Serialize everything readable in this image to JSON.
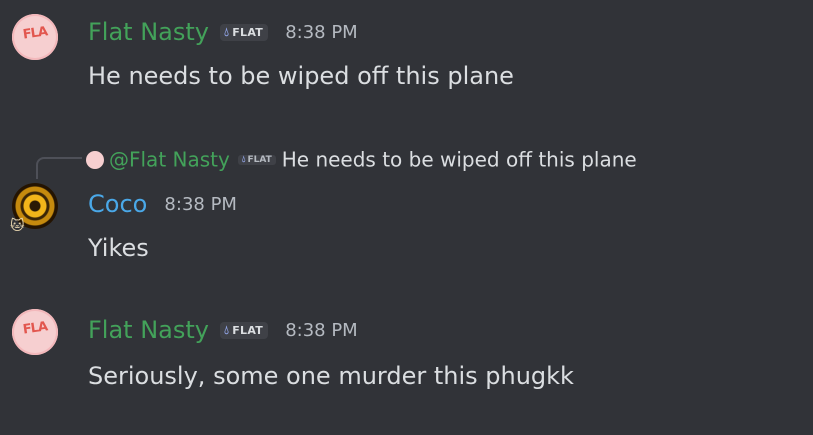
{
  "colors": {
    "background": "#313338",
    "flat_nasty_name": "#43a25a",
    "coco_name": "#4aa8e8",
    "text": "#dbdee1",
    "timestamp": "#b5bac1"
  },
  "messages": [
    {
      "author": "Flat Nasty",
      "tag": "FLAT",
      "tag_icon": "droplet-icon",
      "time": "8:38 PM",
      "text": "He needs to be wiped off this plane"
    },
    {
      "reply": {
        "author": "@Flat Nasty",
        "tag": "FLAT",
        "text": "He needs to be wiped off this plane"
      },
      "author": "Coco",
      "time": "8:38 PM",
      "text": "Yikes"
    },
    {
      "author": "Flat Nasty",
      "tag": "FLAT",
      "tag_icon": "droplet-icon",
      "time": "8:38 PM",
      "text": "Seriously, some one murder this phugkk"
    }
  ]
}
